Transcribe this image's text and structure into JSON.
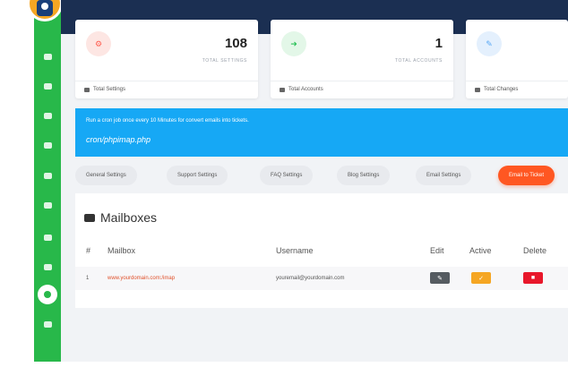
{
  "cards": [
    {
      "value": "108",
      "caption": "TOTAL SETTINGS",
      "footer": "Total Settings",
      "color": "#ff5b4d",
      "icon": "settings-icon"
    },
    {
      "value": "1",
      "caption": "TOTAL ACCOUNTS",
      "footer": "Total Accounts",
      "color": "#2fc25b",
      "icon": "accounts-icon"
    },
    {
      "value": "",
      "caption": "",
      "footer": "Total Changes",
      "color": "#5aa9f5",
      "icon": "changes-icon"
    }
  ],
  "banner": {
    "note": "Run a cron job once every 10 Minutes for convert emails into tickets.",
    "command": "cron/phpimap.php",
    "color": "#16a8f5"
  },
  "tabs": [
    {
      "label": "General Settings"
    },
    {
      "label": "Support Settings"
    },
    {
      "label": "FAQ Settings"
    },
    {
      "label": "Blog Settings"
    },
    {
      "label": "Email Settings"
    },
    {
      "label": "Email to Ticket"
    }
  ],
  "mailboxes": {
    "title": "Mailboxes",
    "columns": {
      "num": "#",
      "mailbox": "Mailbox",
      "username": "Username",
      "edit": "Edit",
      "active": "Active",
      "delete": "Delete"
    },
    "rows": [
      {
        "num": "1",
        "mailbox": "www.yourdomain.com:/imap",
        "username": "youremail@yourdomain.com"
      }
    ]
  },
  "sidebar": {
    "icons": [
      "dashboard-icon",
      "mail-icon",
      "chat-icon",
      "users-icon",
      "document-icon",
      "list-icon",
      "team-icon",
      "cloud-icon",
      "settings-icon",
      "tools-icon"
    ],
    "active_icon": "settings-icon",
    "color": "#28b84a"
  }
}
